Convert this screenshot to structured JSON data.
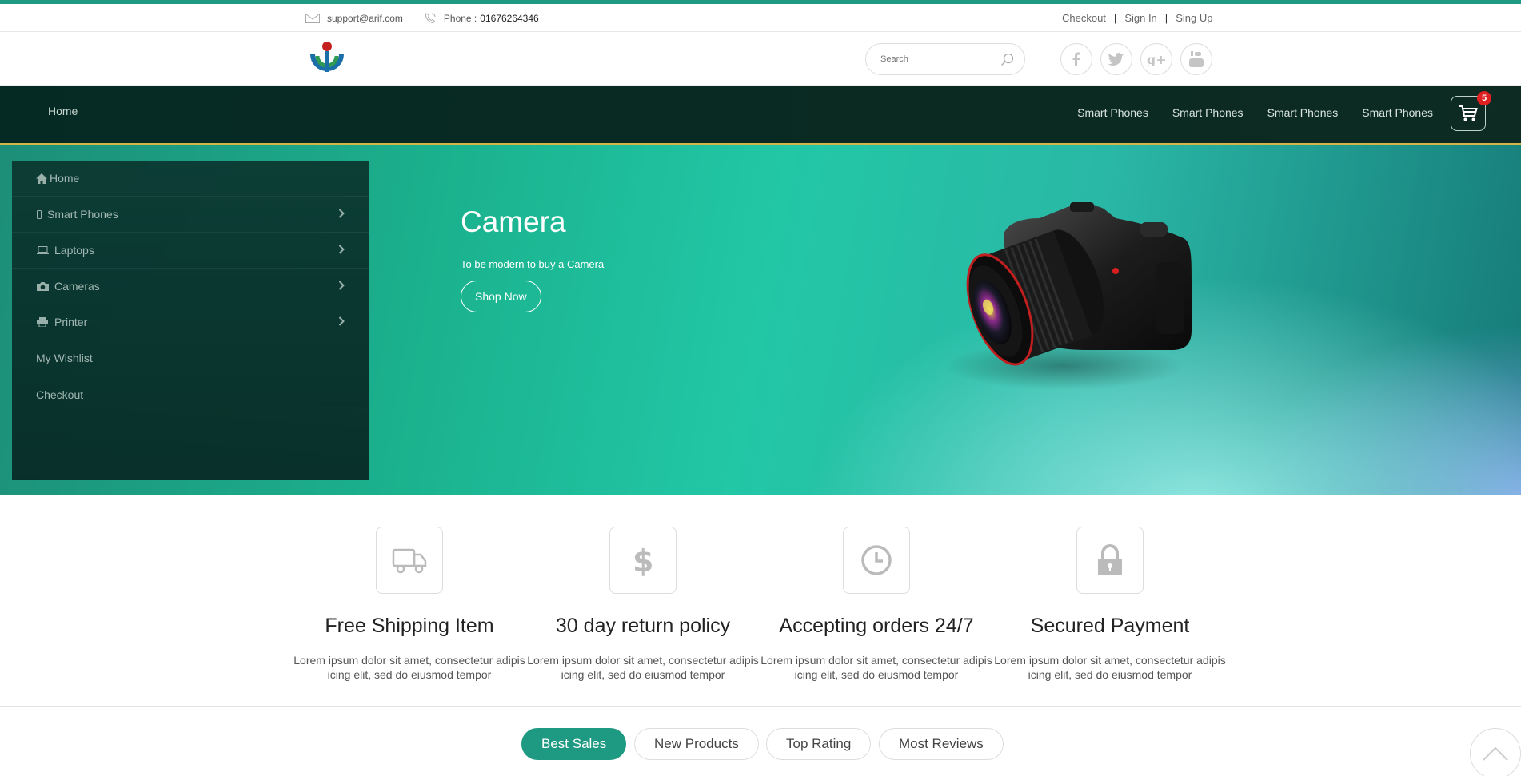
{
  "topbar": {
    "email": "support@arif.com",
    "phone_label": "Phone :",
    "phone_number": "01676264346",
    "links": {
      "checkout": "Checkout",
      "sign_in": "Sign In",
      "sign_up": "Sing Up",
      "separator": "|"
    }
  },
  "header": {
    "search_placeholder": "Search",
    "social": [
      "facebook-icon",
      "twitter-icon",
      "google-plus-icon",
      "youtube-icon"
    ]
  },
  "nav": {
    "home": "Home",
    "links": [
      "Smart Phones",
      "Smart Phones",
      "Smart Phones",
      "Smart Phones"
    ],
    "cart_count": "5"
  },
  "sidebar": {
    "items": [
      {
        "label": "Home",
        "icon": "home-icon"
      },
      {
        "label": "Smart Phones",
        "icon": "mobile-icon"
      },
      {
        "label": "Laptops",
        "icon": "laptop-icon"
      },
      {
        "label": "Cameras",
        "icon": "camera-icon"
      },
      {
        "label": "Printer",
        "icon": "printer-icon"
      },
      {
        "label": "My Wishlist"
      },
      {
        "label": "Checkout"
      }
    ]
  },
  "hero": {
    "title": "Camera",
    "subtitle": "To be modern to buy a Camera",
    "button": "Shop Now"
  },
  "features": [
    {
      "title": "Free Shipping Item",
      "text_line1": "Lorem ipsum dolor sit amet, consectetur adipis",
      "text_line2": "icing elit, sed do eiusmod tempor",
      "icon": "truck-icon"
    },
    {
      "title": "30 day return policy",
      "text_line1": "Lorem ipsum dolor sit amet, consectetur adipis",
      "text_line2": "icing elit, sed do eiusmod tempor",
      "icon": "dollar-icon"
    },
    {
      "title": "Accepting orders 24/7",
      "text_line1": "Lorem ipsum dolor sit amet, consectetur adipis",
      "text_line2": "icing elit, sed do eiusmod tempor",
      "icon": "clock-icon"
    },
    {
      "title": "Secured Payment",
      "text_line1": "Lorem ipsum dolor sit amet, consectetur adipis",
      "text_line2": "icing elit, sed do eiusmod tempor",
      "icon": "lock-icon"
    }
  ],
  "tabs": [
    "Best Sales",
    "New Products",
    "Top Rating",
    "Most Reviews"
  ],
  "colors": {
    "accent": "#1f9a82",
    "nav_bg": "#062a23",
    "badge": "#e02020"
  }
}
